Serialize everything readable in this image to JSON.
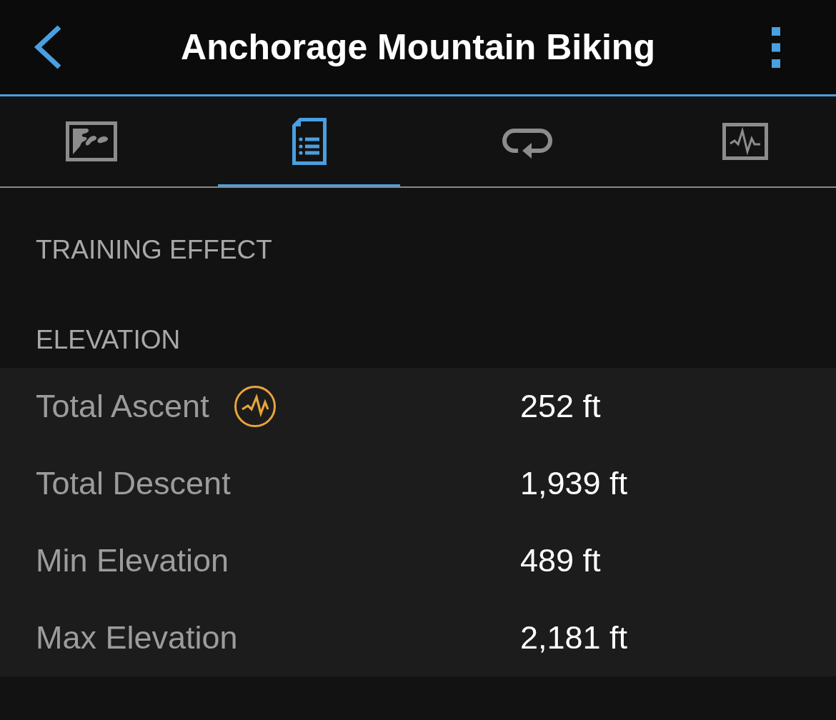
{
  "header": {
    "title": "Anchorage Mountain Biking"
  },
  "tabs": [
    {
      "kind": "map",
      "selected": false
    },
    {
      "kind": "summary",
      "selected": true
    },
    {
      "kind": "laps",
      "selected": false
    },
    {
      "kind": "charts",
      "selected": false
    }
  ],
  "sections": [
    {
      "title": "TRAINING EFFECT"
    },
    {
      "title": "ELEVATION",
      "rows": [
        {
          "label": "Total Ascent",
          "value": "252 ft",
          "chart_icon": true
        },
        {
          "label": "Total Descent",
          "value": "1,939 ft",
          "chart_icon": false
        },
        {
          "label": "Min Elevation",
          "value": "489 ft",
          "chart_icon": false
        },
        {
          "label": "Max Elevation",
          "value": "2,181 ft",
          "chart_icon": false
        }
      ]
    }
  ]
}
